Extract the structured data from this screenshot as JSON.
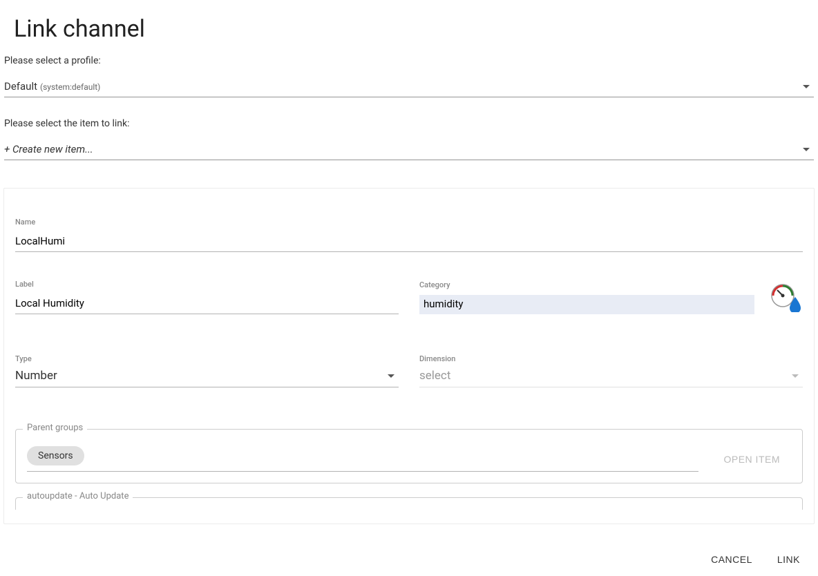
{
  "title": "Link channel",
  "instructions": {
    "profile": "Please select a profile:",
    "item": "Please select the item to link:"
  },
  "profile": {
    "label": "Default",
    "sub": "(system:default)"
  },
  "item_select": {
    "value": "+ Create new item..."
  },
  "fields": {
    "name": {
      "label": "Name",
      "value": "LocalHumi"
    },
    "label": {
      "label": "Label",
      "value": "Local Humidity"
    },
    "category": {
      "label": "Category",
      "value": "humidity"
    },
    "type": {
      "label": "Type",
      "value": "Number"
    },
    "dimension": {
      "label": "Dimension",
      "placeholder": "select"
    }
  },
  "parent_groups": {
    "legend": "Parent groups",
    "chips": [
      "Sensors"
    ],
    "open_item": "OPEN ITEM"
  },
  "autoupdate": {
    "legend": "autoupdate - Auto Update"
  },
  "actions": {
    "cancel": "CANCEL",
    "link": "LINK"
  }
}
